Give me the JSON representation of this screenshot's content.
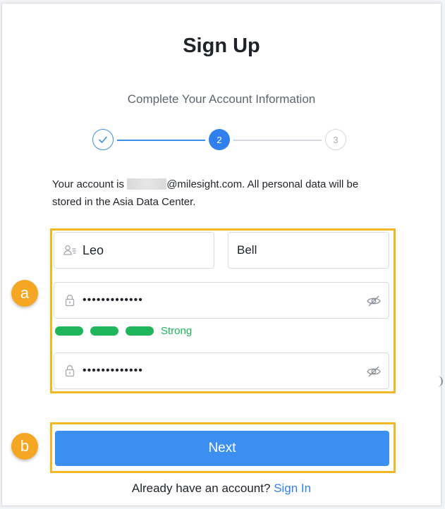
{
  "header": {
    "title": "Sign Up",
    "subtitle": "Complete Your Account Information"
  },
  "steps": [
    {
      "label": "",
      "state": "done"
    },
    {
      "label": "2",
      "state": "active"
    },
    {
      "label": "3",
      "state": "todo"
    }
  ],
  "account_info": {
    "prefix": "Your account is",
    "domain": "@milesight.com.",
    "suffix": "All personal data will be stored in the Asia Data Center."
  },
  "form": {
    "first_name": "Leo",
    "last_name": "Bell",
    "password_masked": "•••••••••••••",
    "confirm_password_masked": "•••••••••••••",
    "strength_label": "Strong",
    "strength_color": "#1fb55a"
  },
  "callouts": {
    "a": "a",
    "b": "b"
  },
  "actions": {
    "next_label": "Next",
    "footer_text": "Already have an account?",
    "sign_in_label": "Sign In"
  },
  "colors": {
    "primary": "#2f80ed",
    "button": "#3b8ff0",
    "highlight": "#f2b824",
    "badge": "#f5a623"
  }
}
